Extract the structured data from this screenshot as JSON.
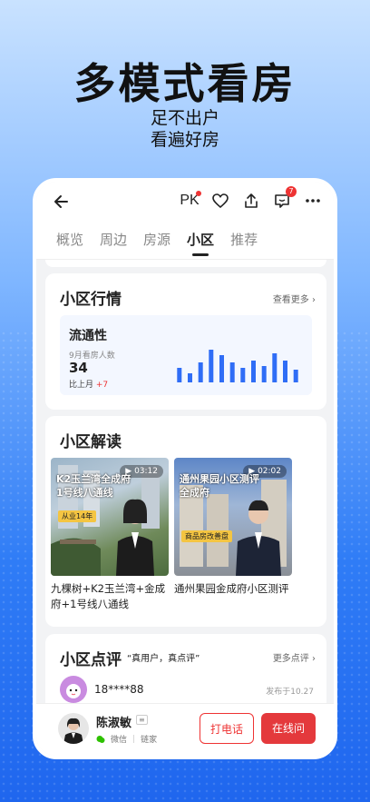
{
  "hero": {
    "title": "多模式看房",
    "subtitle_line1": "足不出户",
    "subtitle_line2": "看遍好房"
  },
  "topbar": {
    "pk_label": "PK",
    "msg_badge_count": "7"
  },
  "tabs": [
    {
      "label": "概览",
      "active": false
    },
    {
      "label": "周边",
      "active": false
    },
    {
      "label": "房源",
      "active": false
    },
    {
      "label": "小区",
      "active": true
    },
    {
      "label": "推荐",
      "active": false
    }
  ],
  "market": {
    "title": "小区行情",
    "more": "查看更多",
    "box_title": "流通性",
    "metric_label": "9月看房人数",
    "metric_value": "34",
    "compare_label": "比上月",
    "compare_delta": "+7",
    "bar_levels": [
      0.4,
      0.25,
      0.55,
      0.9,
      0.75,
      0.55,
      0.4,
      0.6,
      0.45,
      0.8,
      0.6,
      0.35
    ]
  },
  "reading": {
    "title": "小区解读",
    "videos": [
      {
        "duration": "03:12",
        "overlay": "K2玉兰湾全成府\n1号线八通线",
        "badge": "从业14年",
        "caption": "九棵树+K2玉兰湾+金成府+1号线八通线"
      },
      {
        "duration": "02:02",
        "overlay": "通州果园小区测评\n全成府",
        "badge": "商品房改善盘",
        "caption": "通州果园金成府小区测评"
      }
    ]
  },
  "reviews": {
    "title": "小区点评",
    "tagline": "“真用户，真点评”",
    "more": "更多点评",
    "first_user": "18****88",
    "first_date": "发布于10.27"
  },
  "agent": {
    "name": "陈淑敏",
    "wechat": "微信",
    "company": "链家",
    "call_label": "打电话",
    "chat_label": "在线问"
  },
  "colors": {
    "accent_red": "#e4393c",
    "chart_blue": "#2f6df6"
  }
}
